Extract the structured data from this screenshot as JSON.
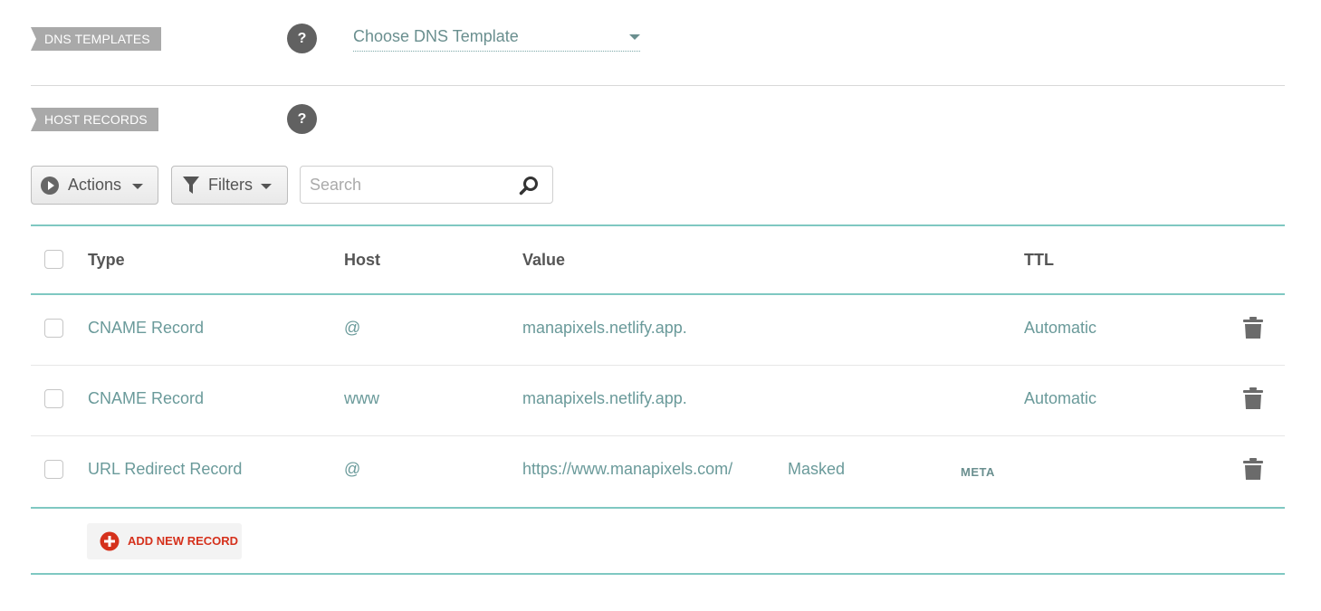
{
  "dns_templates": {
    "tag_label": "DNS TEMPLATES",
    "help": "?",
    "select_value": "Choose DNS Template"
  },
  "host_records": {
    "tag_label": "HOST RECORDS",
    "help": "?"
  },
  "toolbar": {
    "actions_label": "Actions",
    "filters_label": "Filters",
    "search_placeholder": "Search"
  },
  "table": {
    "headers": {
      "type": "Type",
      "host": "Host",
      "value": "Value",
      "ttl": "TTL"
    },
    "rows": [
      {
        "type": "CNAME Record",
        "host": "@",
        "value": "manapixels.netlify.app.",
        "extra": "",
        "meta": "",
        "ttl": "Automatic"
      },
      {
        "type": "CNAME Record",
        "host": "www",
        "value": "manapixels.netlify.app.",
        "extra": "",
        "meta": "",
        "ttl": "Automatic"
      },
      {
        "type": "URL Redirect Record",
        "host": "@",
        "value": "https://www.manapixels.com/",
        "extra": "Masked",
        "meta": "META",
        "ttl": ""
      }
    ]
  },
  "add_record_label": "ADD NEW RECORD",
  "colors": {
    "accent_teal": "#7fc8c2",
    "value_text": "#6a9a9a",
    "add_red": "#d5311c",
    "tag_gray": "#a9a9a9"
  }
}
